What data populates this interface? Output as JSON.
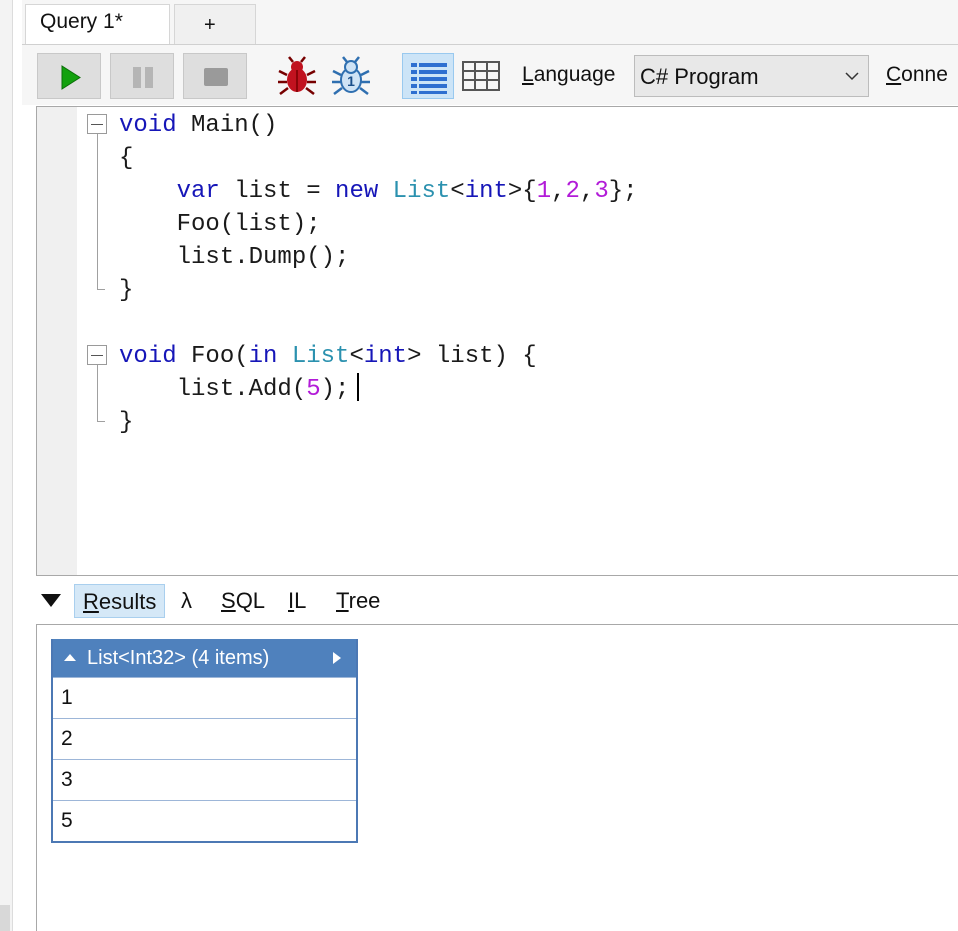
{
  "tabs": {
    "active": "Query 1*",
    "add": "+"
  },
  "toolbar": {
    "language_label_prefix": "L",
    "language_label_rest": "anguage",
    "language_value": "C# Program",
    "connection_prefix": "C",
    "connection_rest": "onne",
    "icons": [
      "run-icon",
      "pause-icon",
      "stop-icon",
      "bug-icon",
      "bug-step-icon",
      "rich-text-results-icon",
      "grid-results-icon",
      "chevron-down-icon"
    ]
  },
  "editor": {
    "lines": [
      [
        {
          "t": "void",
          "c": "kw"
        },
        {
          "t": " Main()"
        }
      ],
      [
        {
          "t": "{"
        }
      ],
      [
        {
          "t": "    "
        },
        {
          "t": "var",
          "c": "kw"
        },
        {
          "t": " list = "
        },
        {
          "t": "new",
          "c": "kw"
        },
        {
          "t": " "
        },
        {
          "t": "List",
          "c": "ty"
        },
        {
          "t": "<"
        },
        {
          "t": "int",
          "c": "kw"
        },
        {
          "t": ">{"
        },
        {
          "t": "1",
          "c": "num"
        },
        {
          "t": ","
        },
        {
          "t": "2",
          "c": "num"
        },
        {
          "t": ","
        },
        {
          "t": "3",
          "c": "num"
        },
        {
          "t": "};"
        }
      ],
      [
        {
          "t": "    Foo(list);"
        }
      ],
      [
        {
          "t": "    list.Dump();"
        }
      ],
      [
        {
          "t": "}"
        }
      ],
      [
        {
          "t": ""
        }
      ],
      [
        {
          "t": "void",
          "c": "kw"
        },
        {
          "t": " Foo("
        },
        {
          "t": "in",
          "c": "kw"
        },
        {
          "t": " "
        },
        {
          "t": "List",
          "c": "ty"
        },
        {
          "t": "<"
        },
        {
          "t": "int",
          "c": "kw"
        },
        {
          "t": "> list) {"
        }
      ],
      [
        {
          "t": "    list.Add("
        },
        {
          "t": "5",
          "c": "num"
        },
        {
          "t": ");"
        }
      ],
      [
        {
          "t": "}"
        }
      ]
    ]
  },
  "result_tabs": {
    "results_prefix": "R",
    "results_rest": "esults",
    "lambda": "λ",
    "sql_prefix": "S",
    "sql_rest": "QL",
    "il_prefix": "I",
    "il_rest": "L",
    "tree_prefix": "T",
    "tree_rest": "ree"
  },
  "results": {
    "header": "List<Int32> (4 items)",
    "rows": [
      "1",
      "2",
      "3",
      "5"
    ]
  }
}
